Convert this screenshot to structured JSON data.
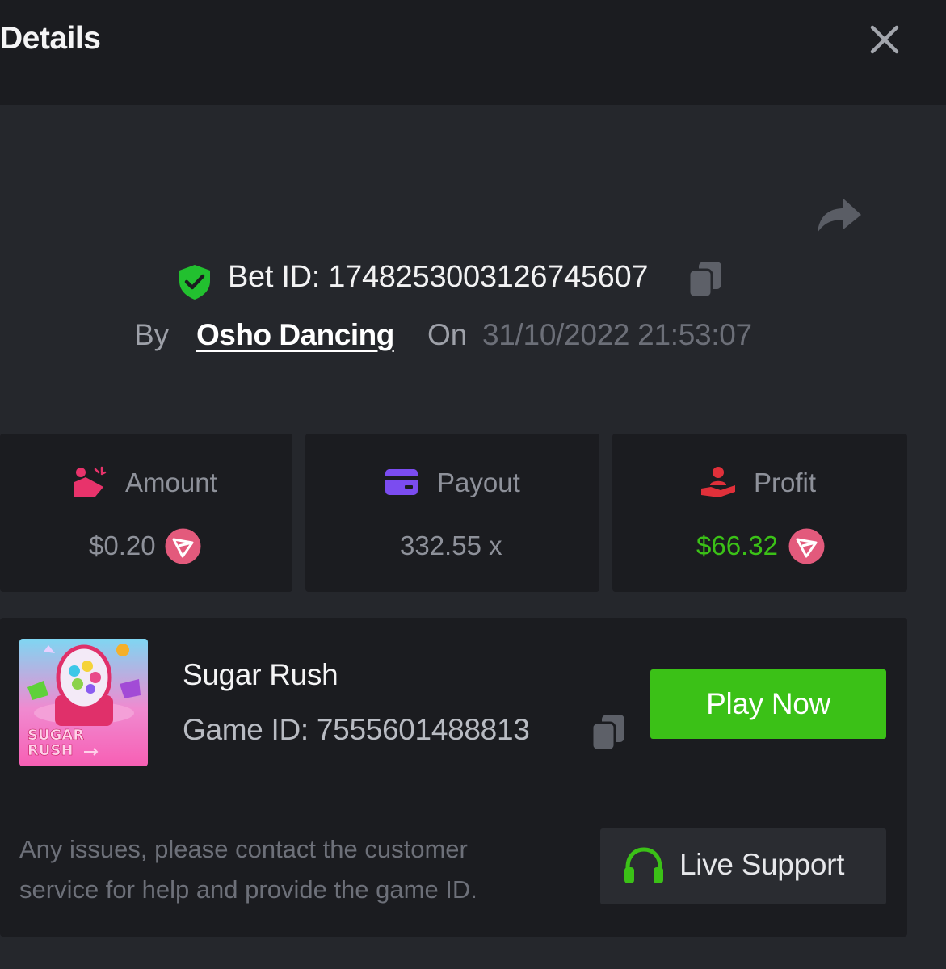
{
  "header": {
    "title": "Details"
  },
  "bet": {
    "id_label": "Bet ID: 1748253003126745607",
    "by_label": "By",
    "username": "Osho Dancing",
    "on_label": "On",
    "datetime": "31/10/2022 21:53:07"
  },
  "stats": {
    "amount": {
      "label": "Amount",
      "value": "$0.20",
      "icon": "coins-hand-icon"
    },
    "payout": {
      "label": "Payout",
      "value": "332.55 x",
      "icon": "card-icon"
    },
    "profit": {
      "label": "Profit",
      "value": "$66.32",
      "icon": "hand-user-icon"
    }
  },
  "game": {
    "name": "Sugar Rush",
    "id_label": "Game ID: 7555601488813",
    "thumb_text_line1": "SUGAR",
    "thumb_text_line2": "RUSH",
    "play_label": "Play Now"
  },
  "support": {
    "notice": "Any issues, please contact the customer service for help and provide the game ID.",
    "button_label": "Live Support"
  },
  "colors": {
    "accent_green": "#3bc117",
    "profit_green": "#3bc117",
    "amount_pink": "#e8336b",
    "payout_purple": "#7b4cf0",
    "profit_red": "#e0303a"
  }
}
